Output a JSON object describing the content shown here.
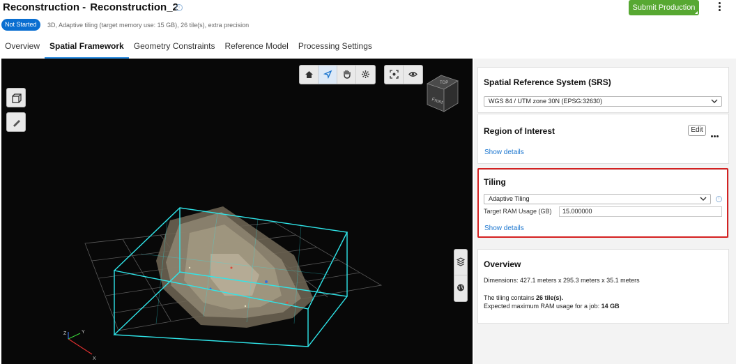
{
  "header": {
    "title_prefix": "Reconstruction -",
    "title_name": "Reconstruction_2",
    "submit_label": "Submit Production",
    "status": "Not Started",
    "subtitle": "3D, Adaptive tiling (target memory use: 15 GB), 26 tile(s), extra precision"
  },
  "tabs": [
    {
      "label": "Overview"
    },
    {
      "label": "Spatial Framework"
    },
    {
      "label": "Geometry Constraints"
    },
    {
      "label": "Reference Model"
    },
    {
      "label": "Processing Settings"
    }
  ],
  "viewport": {
    "axes": {
      "x": "X",
      "y": "Y",
      "z": "Z"
    },
    "view_cube": {
      "top": "TOP",
      "front": "Front"
    },
    "colors": {
      "tile_box": "#2fe6ea",
      "grid": "#6a6a6a",
      "background": "#080808"
    },
    "toolbar_icons": [
      "home-icon",
      "orbit-icon",
      "pan-icon",
      "settings-icon",
      "focus-icon",
      "eye-icon"
    ],
    "left_tools": [
      "box-icon",
      "ruler-icon"
    ],
    "side_tools": [
      "layers-icon",
      "globe-icon"
    ]
  },
  "srs": {
    "title": "Spatial Reference System (SRS)",
    "value": "WGS 84 / UTM zone 30N (EPSG:32630)"
  },
  "roi": {
    "title": "Region of Interest",
    "edit_label": "Edit",
    "show_details": "Show details"
  },
  "tiling": {
    "title": "Tiling",
    "mode": "Adaptive Tiling",
    "ram_label": "Target RAM Usage (GB)",
    "ram_value": "15.000000",
    "show_details": "Show details"
  },
  "overview": {
    "title": "Overview",
    "dimensions": "Dimensions: 427.1 meters x 295.3 meters x 35.1 meters",
    "tiling_prefix": "The tiling contains ",
    "tiling_count": "26 tile(s).",
    "ram_prefix": "Expected maximum RAM usage for a job: ",
    "ram_value": "14 GB"
  },
  "accent": {
    "tab_underline": "#2a8be0",
    "submit": "#57a832",
    "status": "#0a6fd1",
    "highlight": "#d42020",
    "link": "#1a75cf"
  }
}
